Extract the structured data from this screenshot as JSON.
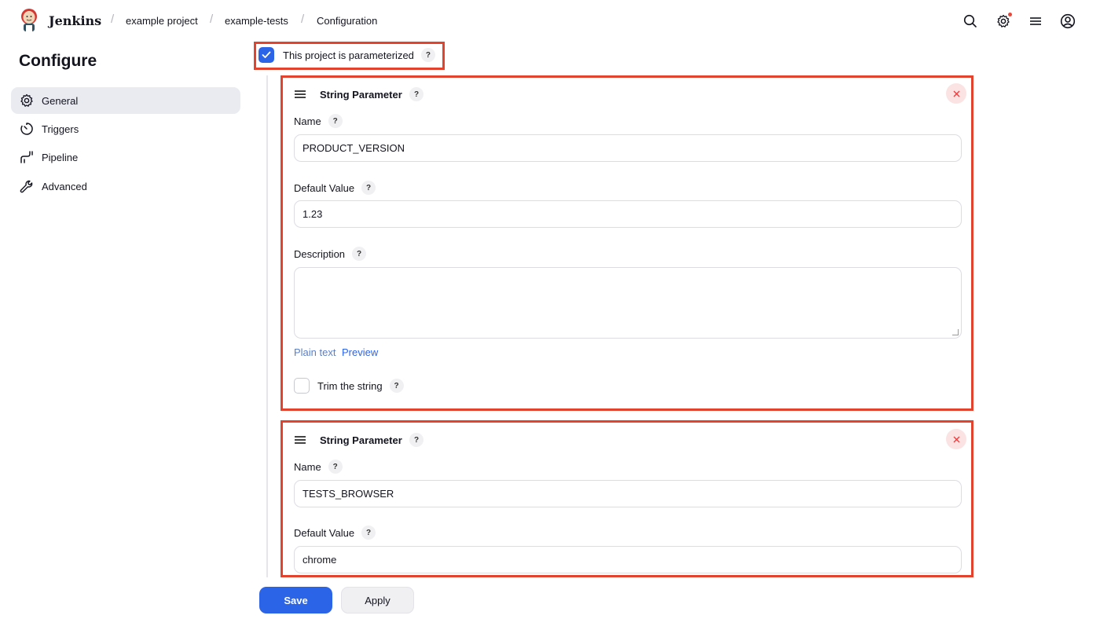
{
  "header": {
    "brand": "Jenkins",
    "breadcrumbs": [
      "example project",
      "example-tests",
      "Configuration"
    ],
    "icons": [
      "search-icon",
      "settings-icon",
      "menu-icon",
      "user-icon"
    ]
  },
  "sidebar": {
    "title": "Configure",
    "items": [
      {
        "label": "General",
        "icon": "gear-icon",
        "active": true
      },
      {
        "label": "Triggers",
        "icon": "timer-icon",
        "active": false
      },
      {
        "label": "Pipeline",
        "icon": "pipeline-icon",
        "active": false
      },
      {
        "label": "Advanced",
        "icon": "wrench-icon",
        "active": false
      }
    ]
  },
  "main": {
    "parameterized_label": "This project is parameterized",
    "parameterized_checked": true,
    "help_glyph": "?",
    "parameters": [
      {
        "type_label": "String Parameter",
        "name_label": "Name",
        "name_value": "PRODUCT_VERSION",
        "default_label": "Default Value",
        "default_value": "1.23",
        "description_label": "Description",
        "description_value": "",
        "plain_text_label": "Plain text",
        "preview_label": "Preview",
        "trim_label": "Trim the string",
        "trim_checked": false
      },
      {
        "type_label": "String Parameter",
        "name_label": "Name",
        "name_value": "TESTS_BROWSER",
        "default_label": "Default Value",
        "default_value": "chrome"
      }
    ]
  },
  "footer": {
    "save_label": "Save",
    "apply_label": "Apply"
  },
  "colors": {
    "accent": "#2c64e8",
    "highlight_box": "#e2432e",
    "active_nav_bg": "#e9ebf1"
  }
}
